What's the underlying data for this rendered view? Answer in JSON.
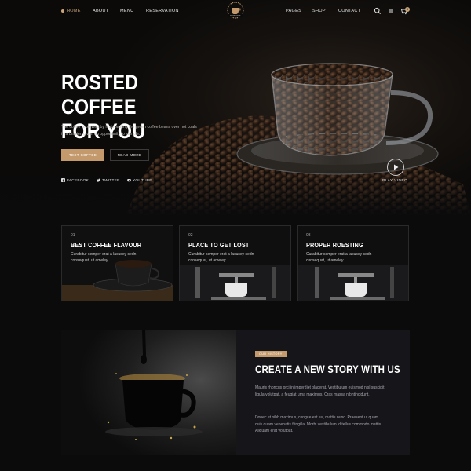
{
  "colors": {
    "accent": "#c49a6c",
    "background": "#0b0b0c",
    "panel": "#15151a"
  },
  "nav": {
    "items": [
      {
        "label": "HOME",
        "active": true
      },
      {
        "label": "ABOUT"
      },
      {
        "label": "MENU"
      },
      {
        "label": "RESERVATION"
      },
      {
        "label": "PAGES"
      },
      {
        "label": "SHOP"
      },
      {
        "label": "CONTACT"
      }
    ],
    "logo_text": "COFFEE",
    "icons": [
      "search-icon",
      "menu-icon",
      "cart-icon"
    ],
    "cart_count": "0"
  },
  "hero": {
    "title_line1": "ROSTED COFFEE",
    "title_line2": "FOR YOU",
    "description": "The coffee is brewed by first roasting the green coffee beans over hot coals in a brazier. given an opportunity to sample.",
    "primary_button": "TEXT COFFEE",
    "secondary_button": "READ MORE",
    "socials": [
      {
        "label": "FACEBOOK",
        "icon": "facebook-icon"
      },
      {
        "label": "TWITTER",
        "icon": "twitter-icon"
      },
      {
        "label": "YOUTUBE",
        "icon": "youtube-icon"
      }
    ],
    "play_label": "PLAY VIDEO"
  },
  "features": [
    {
      "number": "01",
      "title": "BEST COFFEE FLAVOUR",
      "description": "Curabitur semper erat a lacusey sedn consequat, ut ameley."
    },
    {
      "number": "02",
      "title": "PLACE TO GET LOST",
      "description": "Curabitur semper erat a lacusey sedn consequat, ut ameley."
    },
    {
      "number": "03",
      "title": "PROPER ROESTING",
      "description": "Curabitur semper erat a lacusey sedn consequat, ut ameley."
    }
  ],
  "story": {
    "badge": "OUR HISTORY",
    "title": "CREATE A NEW STORY WITH US",
    "paragraph1": "Mauris rhoncus orci in imperdiet placerat. Vestibulum euismod nisl suscipit ligula volutpat, a feugiat urna maximus. Cras massa nibhtincidunt.",
    "paragraph2": "Donec et nibh maximus, congue est eu, mattis nunc. Praesent ut quam quis quam venenatis fringilla. Morbi vestibulum id tellus commodo mattis. Aliquam erat volutpat."
  }
}
